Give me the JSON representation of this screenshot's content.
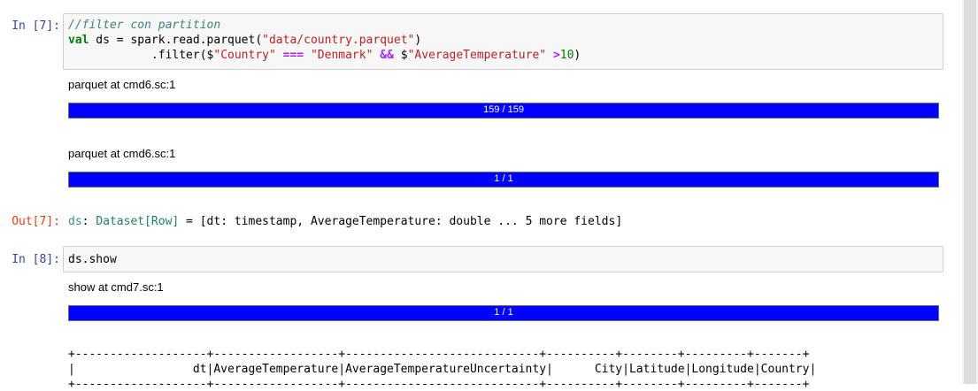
{
  "cells": [
    {
      "prompt": "In [7]:",
      "code_lines": [
        [
          {
            "t": "comment",
            "v": "//filter con partition"
          }
        ],
        [
          {
            "t": "keyword",
            "v": "val"
          },
          {
            "t": "plain",
            "v": " ds = spark.read.parquet("
          },
          {
            "t": "string",
            "v": "\"data/country.parquet\""
          },
          {
            "t": "plain",
            "v": ")"
          }
        ],
        [
          {
            "t": "plain",
            "v": "            .filter($"
          },
          {
            "t": "string",
            "v": "\"Country\""
          },
          {
            "t": "plain",
            "v": " "
          },
          {
            "t": "op",
            "v": "==="
          },
          {
            "t": "plain",
            "v": " "
          },
          {
            "t": "string",
            "v": "\"Denmark\""
          },
          {
            "t": "plain",
            "v": " "
          },
          {
            "t": "op",
            "v": "&&"
          },
          {
            "t": "plain",
            "v": " $"
          },
          {
            "t": "string",
            "v": "\"AverageTemperature\""
          },
          {
            "t": "plain",
            "v": " "
          },
          {
            "t": "op",
            "v": ">"
          },
          {
            "t": "num",
            "v": "10"
          },
          {
            "t": "plain",
            "v": ")"
          }
        ]
      ],
      "outputs": {
        "job1_label": "parquet at cmd6.sc:1",
        "job1_progress": "159 / 159",
        "job1_fraction": 1.0,
        "job2_label": "parquet at cmd6.sc:1",
        "job2_progress": "1 / 1",
        "job2_fraction": 1.0,
        "out_prompt": "Out[7]:",
        "out_name": "ds",
        "out_sep": ": ",
        "out_type": "Dataset[Row]",
        "out_rest": " = [dt: timestamp, AverageTemperature: double ... 5 more fields]"
      }
    },
    {
      "prompt": "In [8]:",
      "code": "ds.show",
      "outputs": {
        "job_label": "show at cmd7.sc:1",
        "job_progress": "1 / 1",
        "job_fraction": 1.0,
        "table_border": "+-------------------+------------------+----------------------------+----------+--------+---------+-------+",
        "table_header": "|                 dt|AverageTemperature|AverageTemperatureUncertainty|      City|Latitude|Longitude|Country|"
      }
    }
  ],
  "colors": {
    "progress_fill": "#0000ff",
    "prompt_in": "#303f9f",
    "prompt_out": "#d84315"
  }
}
